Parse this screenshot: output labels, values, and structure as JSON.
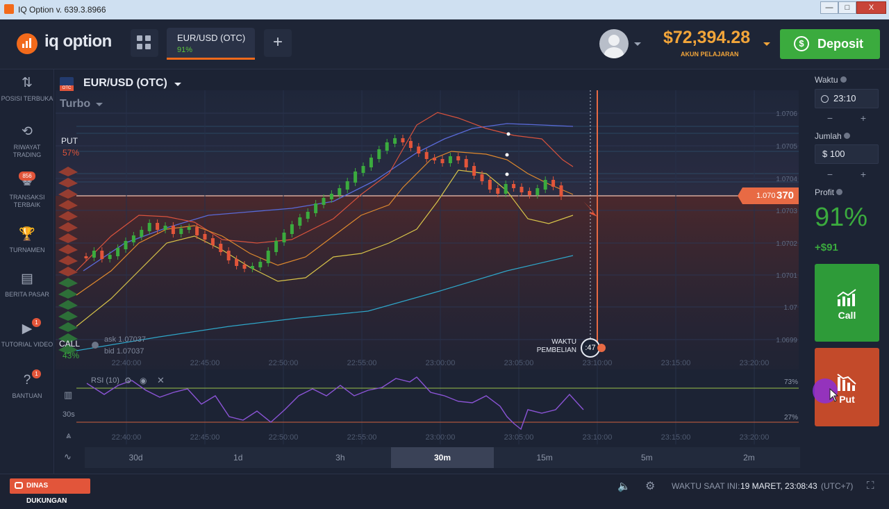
{
  "window": {
    "title": "IQ Option v. 639.3.8966",
    "minimize": "—",
    "maximize": "□",
    "close": "X"
  },
  "header": {
    "logo_text": "iq option",
    "tab": {
      "name": "EUR/USD (OTC)",
      "percent": "91%"
    },
    "add_tab": "+",
    "balance": "$72,394.28",
    "account_type": "AKUN PELAJARAN",
    "deposit_label": "Deposit"
  },
  "sidebar": {
    "items": [
      {
        "label": "POSISI TERBUKA",
        "icon": "arrows-updown-icon",
        "glyph": "⇅"
      },
      {
        "label": "RIWAYAT TRADING",
        "icon": "history-icon",
        "glyph": "⟲"
      },
      {
        "label": "TRANSAKSI TERBAIK",
        "icon": "top-trades-icon",
        "glyph": "♚",
        "badge": "856"
      },
      {
        "label": "TURNAMEN",
        "icon": "trophy-icon",
        "glyph": "🏆"
      },
      {
        "label": "BERITA PASAR",
        "icon": "news-icon",
        "glyph": "▤"
      },
      {
        "label": "TUTORIAL VIDEO",
        "icon": "play-icon",
        "glyph": "▶",
        "badge": "1"
      },
      {
        "label": "BANTUAN",
        "icon": "help-icon",
        "glyph": "?",
        "badge": "1"
      }
    ]
  },
  "chart": {
    "asset": "EUR/USD (OTC)",
    "asset_flag": "OTC",
    "mode": "Turbo",
    "put_label": "PUT",
    "put_pct": "57%",
    "call_label": "CALL",
    "call_pct": "43%",
    "ask": "ask 1.07037",
    "bid": "bid 1.07037",
    "price_tag_small": "1.070",
    "price_tag_big": "370",
    "price_levels": [
      "1.0706",
      "1.0705",
      "1.0704",
      "1.0703",
      "1.0702",
      "1.0701",
      "1.07",
      "1.0699"
    ],
    "time_labels": [
      "22:40:00",
      "22:45:00",
      "22:50:00",
      "22:55:00",
      "23:00:00",
      "23:05:00",
      "23:10:00",
      "23:15:00",
      "23:20:00"
    ],
    "purchase_label_1": "WAKTU",
    "purchase_label_2": "PEMBELIAN",
    "countdown": ":47",
    "rsi_label": "RSI (10)",
    "rsi_upper": "73%",
    "rsi_lower": "27%",
    "tool_interval": "30s",
    "timeframes": [
      "30d",
      "1d",
      "3h",
      "30m",
      "15m",
      "5m",
      "2m"
    ],
    "active_timeframe": "30m",
    "colors": {
      "bull": "#3bab3e",
      "bear": "#e2553a",
      "accent": "#f26a1b"
    }
  },
  "trade_panel": {
    "time_label": "Waktu",
    "time_value": "23:10",
    "amount_label": "Jumlah",
    "amount_value": "$ 100",
    "profit_label": "Profit",
    "profit_pct": "91%",
    "profit_gain": "+$91",
    "call_label": "Call",
    "put_label": "Put",
    "minus": "−",
    "plus": "+"
  },
  "footer": {
    "support_label": "DINAS DUKUNGAN",
    "time_label": "WAKTU SAAT INI:",
    "time_value": "19 MARET, 23:08:43",
    "timezone": "(UTC+7)"
  }
}
